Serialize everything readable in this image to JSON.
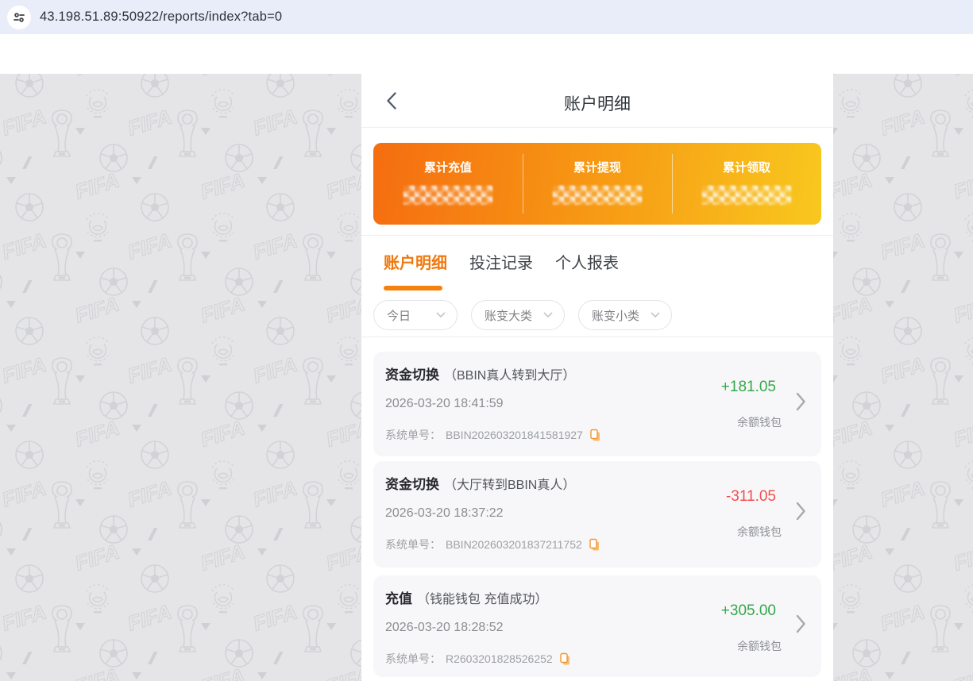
{
  "browser": {
    "url": "43.198.51.89:50922/reports/index?tab=0"
  },
  "header": {
    "title": "账户明细"
  },
  "summary": {
    "items": [
      {
        "label": "累计充值",
        "value_masked": true
      },
      {
        "label": "累计提现",
        "value_masked": true
      },
      {
        "label": "累计领取",
        "value_masked": true
      }
    ]
  },
  "tabs": [
    {
      "label": "账户明细",
      "active": true
    },
    {
      "label": "投注记录",
      "active": false
    },
    {
      "label": "个人报表",
      "active": false
    }
  ],
  "filters": [
    {
      "label": "今日"
    },
    {
      "label": "账变大类"
    },
    {
      "label": "账变小类"
    }
  ],
  "transactions": [
    {
      "type": "资金切换",
      "detail": "（BBIN真人转到大厅）",
      "datetime": "2026-03-20 18:41:59",
      "order_label": "系统单号：",
      "order_no": "BBIN202603201841581927",
      "amount": "+181.05",
      "amount_color": "#36a74a",
      "wallet": "余额钱包"
    },
    {
      "type": "资金切换",
      "detail": "（大厅转到BBIN真人）",
      "datetime": "2026-03-20 18:37:22",
      "order_label": "系统单号：",
      "order_no": "BBIN202603201837211752",
      "amount": "-311.05",
      "amount_color": "#f0504d",
      "wallet": "余额钱包"
    },
    {
      "type": "充值",
      "detail": "（钱能钱包 充值成功）",
      "datetime": "2026-03-20 18:28:52",
      "order_label": "系统单号：",
      "order_no": "R2603201828526252",
      "amount": "+305.00",
      "amount_color": "#36a74a",
      "wallet": "余额钱包"
    }
  ],
  "colors": {
    "accent_orange": "#f6820e",
    "gradient_start": "#f56d10",
    "gradient_end": "#f8c81e",
    "positive": "#36a74a",
    "negative": "#f0504d",
    "pattern_bg": "#e5e5e7",
    "pattern_glyph": "#d2d3d6"
  }
}
